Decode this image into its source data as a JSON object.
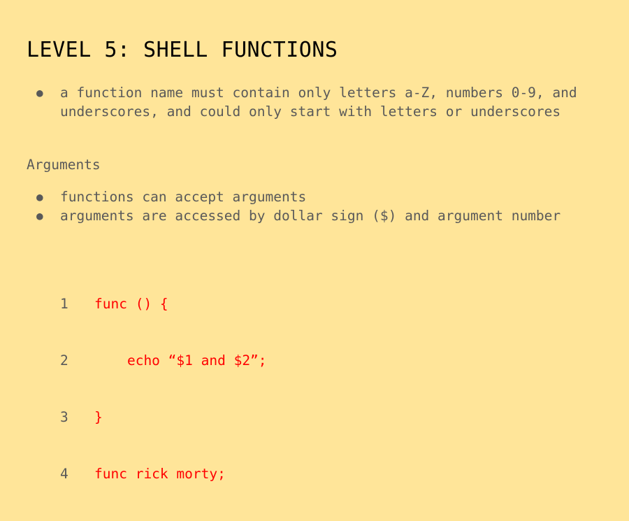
{
  "slide": {
    "title": "LEVEL 5: SHELL FUNCTIONS",
    "bullets_top": [
      "a function name must contain only letters a-Z, numbers 0-9, and underscores, and could only start with letters or underscores"
    ],
    "section_heading": "Arguments",
    "bullets_bottom": [
      "functions can accept arguments",
      "arguments are accessed by dollar sign ($) and argument number"
    ],
    "code": [
      {
        "num": "1",
        "text": "func () {"
      },
      {
        "num": "2",
        "text": "    echo “$1 and $2”;"
      },
      {
        "num": "3",
        "text": "}"
      },
      {
        "num": "4",
        "text": "func rick morty;"
      }
    ]
  },
  "colors": {
    "background": "#ffe599",
    "title": "#000000",
    "body_text": "#595959",
    "code": "#ff0000"
  }
}
